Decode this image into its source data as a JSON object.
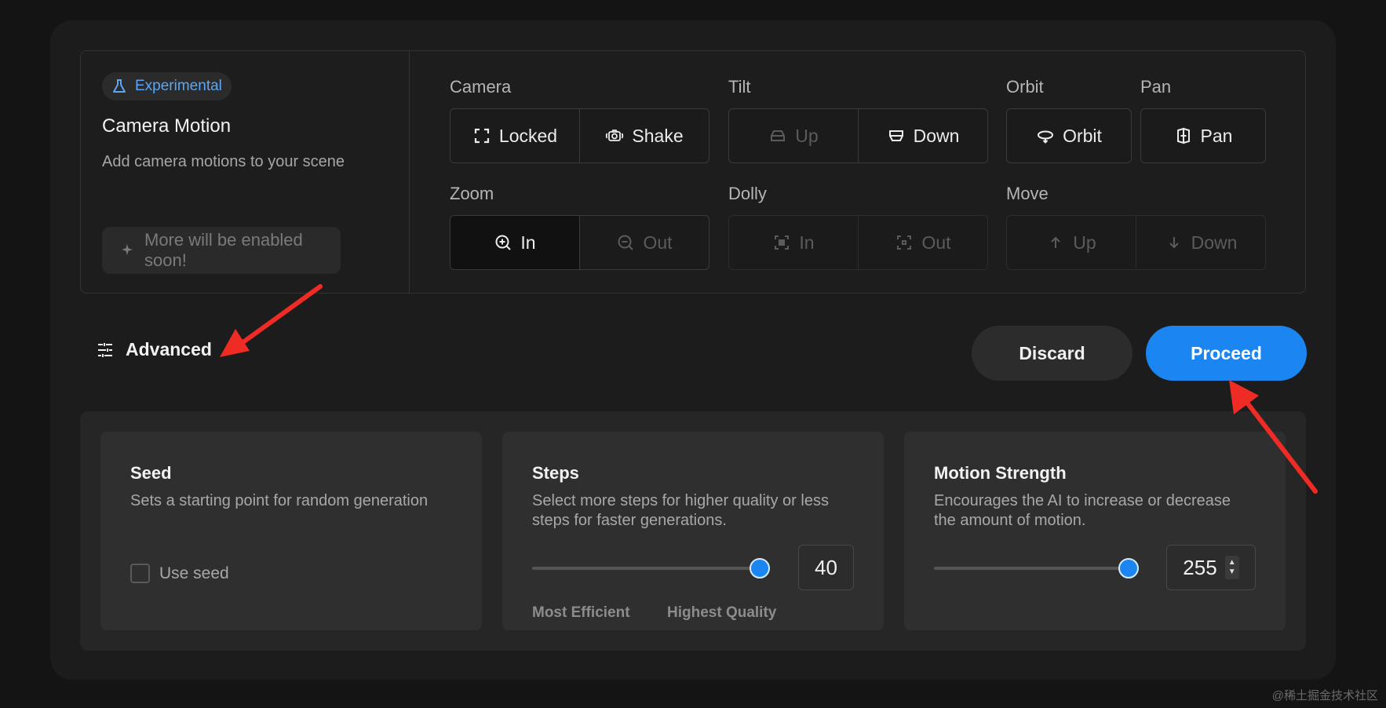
{
  "camera_motion": {
    "badge": "Experimental",
    "title": "Camera Motion",
    "subtitle": "Add camera motions to your scene",
    "soon_label": "More will be enabled soon!"
  },
  "groups": {
    "camera": {
      "label": "Camera",
      "options": [
        "Locked",
        "Shake"
      ]
    },
    "tilt": {
      "label": "Tilt",
      "options": [
        "Up",
        "Down"
      ]
    },
    "orbit": {
      "label": "Orbit",
      "options": [
        "Orbit"
      ]
    },
    "pan": {
      "label": "Pan",
      "options": [
        "Pan"
      ]
    },
    "zoom": {
      "label": "Zoom",
      "options": [
        "In",
        "Out"
      ]
    },
    "dolly": {
      "label": "Dolly",
      "options": [
        "In",
        "Out"
      ]
    },
    "move": {
      "label": "Move",
      "options": [
        "Up",
        "Down"
      ]
    }
  },
  "actions": {
    "advanced_label": "Advanced",
    "discard_label": "Discard",
    "proceed_label": "Proceed"
  },
  "advanced": {
    "seed": {
      "title": "Seed",
      "description": "Sets a starting point for random generation",
      "checkbox_label": "Use seed",
      "checked": false
    },
    "steps": {
      "title": "Steps",
      "description": "Select more steps for higher quality or less steps for faster generations.",
      "value": "40",
      "min_label": "Most Efficient",
      "max_label": "Highest Quality",
      "slider_fraction": 1.0
    },
    "motion_strength": {
      "title": "Motion Strength",
      "description": "Encourages the AI to increase or decrease the amount of motion.",
      "value": "255",
      "slider_fraction": 1.0
    }
  },
  "colors": {
    "accent": "#1b86f2",
    "badge_text": "#5aa6f5"
  },
  "watermark": "@稀土掘金技术社区"
}
